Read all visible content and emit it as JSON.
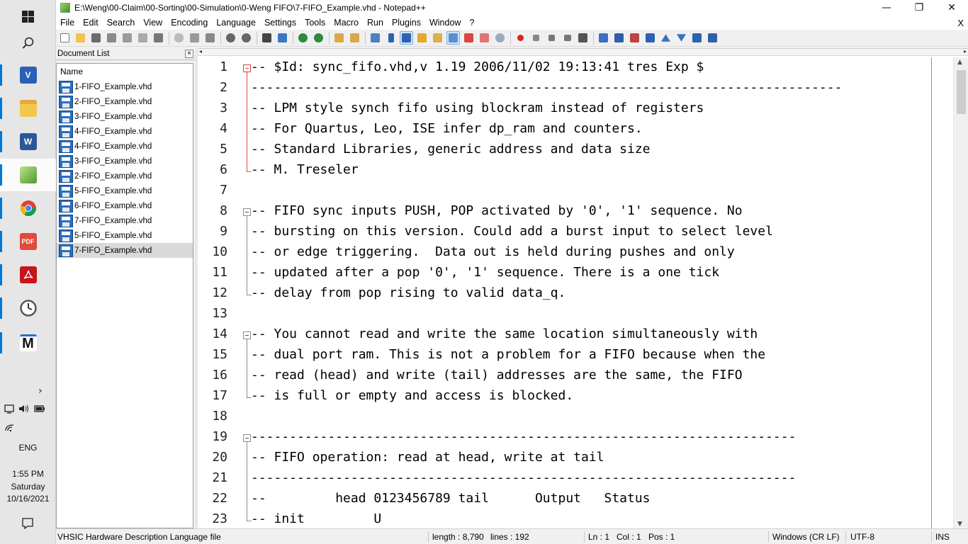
{
  "window": {
    "title": "E:\\Weng\\00-Claim\\00-Sorting\\00-Simulation\\0-Weng FIFO\\7-FIFO_Example.vhd - Notepad++",
    "minimize": "—",
    "restore": "❐",
    "close": "✕"
  },
  "menu": {
    "items": [
      "File",
      "Edit",
      "Search",
      "View",
      "Encoding",
      "Language",
      "Settings",
      "Tools",
      "Macro",
      "Run",
      "Plugins",
      "Window",
      "?"
    ],
    "close_doc": "X"
  },
  "doc_list": {
    "title": "Document List",
    "close": "×",
    "column": "Name",
    "files": [
      "1-FIFO_Example.vhd",
      "2-FIFO_Example.vhd",
      "3-FIFO_Example.vhd",
      "4-FIFO_Example.vhd",
      "4-FIFO_Example.vhd",
      "3-FIFO_Example.vhd",
      "2-FIFO_Example.vhd",
      "5-FIFO_Example.vhd",
      "6-FIFO_Example.vhd",
      "7-FIFO_Example.vhd",
      "5-FIFO_Example.vhd",
      "7-FIFO_Example.vhd"
    ],
    "selected_index": 11
  },
  "editor": {
    "lines": [
      "-- $Id: sync_fifo.vhd,v 1.19 2006/11/02 19:13:41 tres Exp $",
      "-----------------------------------------------------------------------------",
      "-- LPM style synch fifo using blockram instead of registers",
      "-- For Quartus, Leo, ISE infer dp_ram and counters.",
      "-- Standard Libraries, generic address and data size",
      "-- M. Treseler",
      "",
      "-- FIFO sync inputs PUSH, POP activated by '0', '1' sequence. No",
      "-- bursting on this version. Could add a burst input to select level",
      "-- or edge triggering.  Data out is held during pushes and only",
      "-- updated after a pop '0', '1' sequence. There is a one tick",
      "-- delay from pop rising to valid data_q.",
      "",
      "-- You cannot read and write the same location simultaneously with",
      "-- dual port ram. This is not a problem for a FIFO because when the",
      "-- read (head) and write (tail) addresses are the same, the FIFO",
      "-- is full or empty and access is blocked.",
      "",
      "-----------------------------------------------------------------------",
      "-- FIFO operation: read at head, write at tail",
      "-----------------------------------------------------------------------",
      "--         head 0123456789 tail      Output   Status",
      "-- init         U"
    ]
  },
  "status": {
    "language": "VHSIC Hardware Description Language file",
    "length": "length : 8,790",
    "lines": "lines : 192",
    "ln": "Ln : 1",
    "col": "Col : 1",
    "pos": "Pos : 1",
    "eol": "Windows (CR LF)",
    "encoding": "UTF-8",
    "mode": "INS"
  },
  "taskbar": {
    "icons": [
      "windows-start",
      "search",
      "visual-studio",
      "file-explorer",
      "word",
      "notepad-plus-plus",
      "chrome",
      "pdf-tool",
      "acrobat",
      "clock-app",
      "m-app"
    ],
    "time": "1:55 PM",
    "day": "Saturday",
    "date": "10/16/2021",
    "language": "ENG",
    "pdf_label": "PDF",
    "word_label": "W",
    "vs_label": "V",
    "m_label": "M"
  }
}
